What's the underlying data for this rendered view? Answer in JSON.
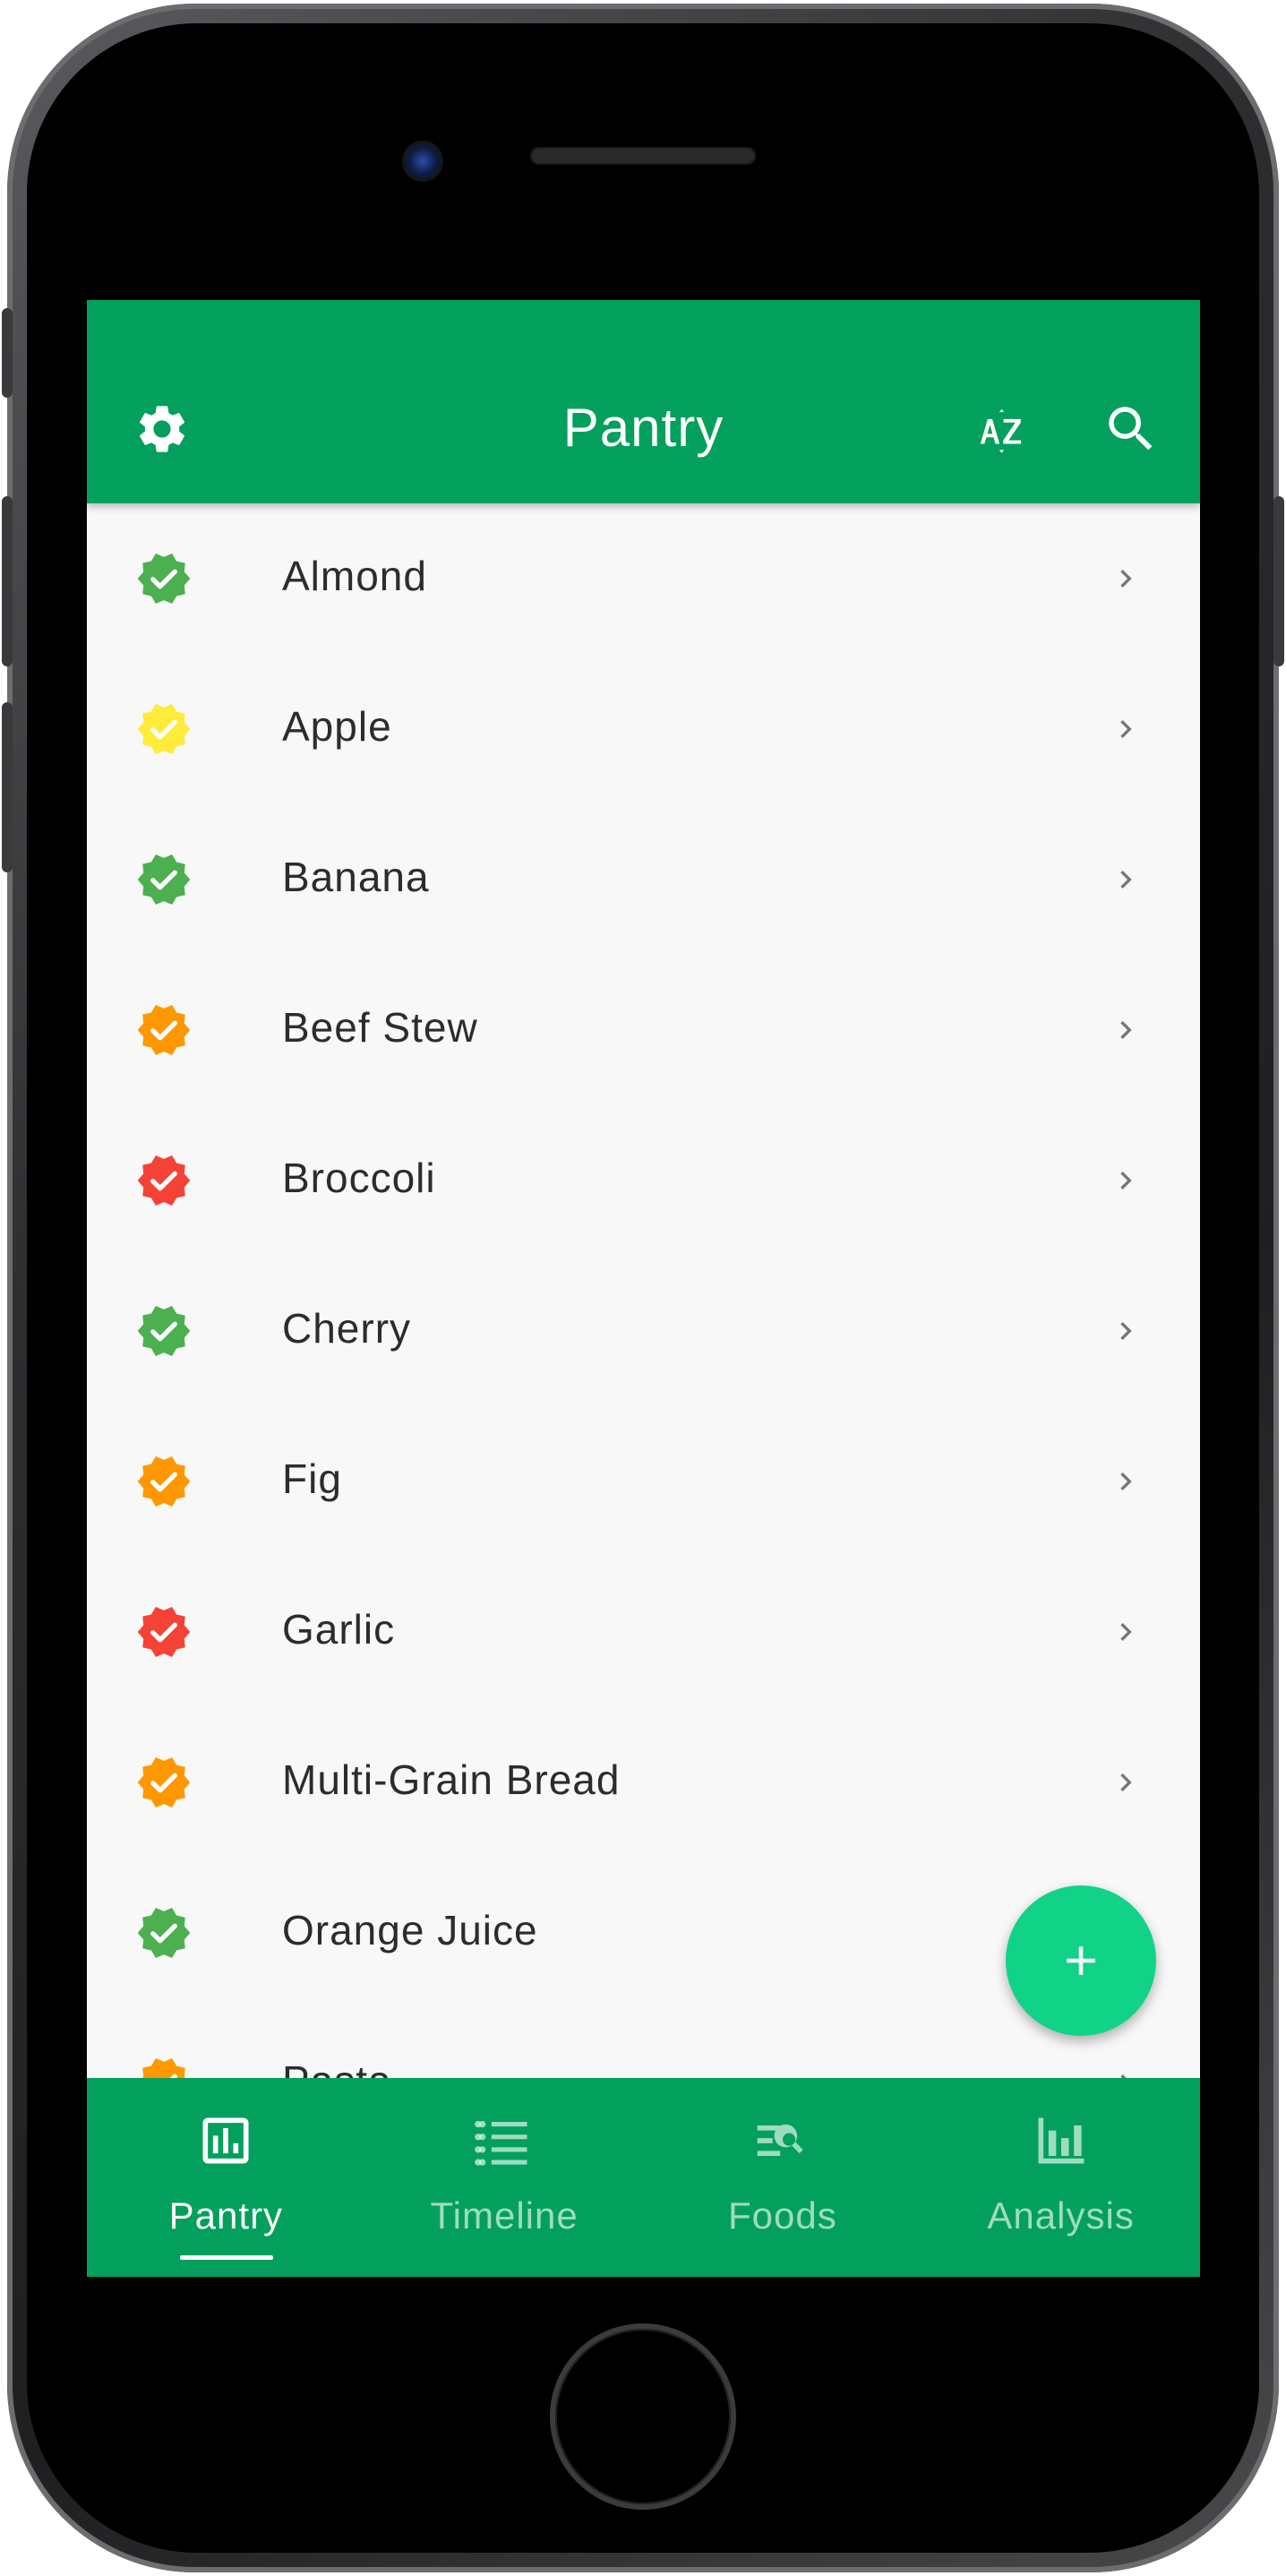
{
  "app_bar": {
    "title": "Pantry",
    "settings_icon": "gear-icon",
    "sort_icon": "sort-az-icon",
    "search_icon": "search-icon"
  },
  "pantry_items": [
    {
      "name": "Almond",
      "status_color": "#4caf50",
      "icon": "verified-badge-icon"
    },
    {
      "name": "Apple",
      "status_color": "#ffeb3b",
      "icon": "verified-badge-icon"
    },
    {
      "name": "Banana",
      "status_color": "#4caf50",
      "icon": "verified-badge-icon"
    },
    {
      "name": "Beef Stew",
      "status_color": "#ff9800",
      "icon": "verified-badge-icon"
    },
    {
      "name": "Broccoli",
      "status_color": "#f44336",
      "icon": "verified-badge-icon"
    },
    {
      "name": "Cherry",
      "status_color": "#4caf50",
      "icon": "verified-badge-icon"
    },
    {
      "name": "Fig",
      "status_color": "#ff9800",
      "icon": "verified-badge-icon"
    },
    {
      "name": "Garlic",
      "status_color": "#f44336",
      "icon": "verified-badge-icon"
    },
    {
      "name": "Multi-Grain Bread",
      "status_color": "#ff9800",
      "icon": "verified-badge-icon"
    },
    {
      "name": "Orange Juice",
      "status_color": "#4caf50",
      "icon": "verified-badge-icon"
    },
    {
      "name": "Pasta",
      "status_color": "#ff9800",
      "icon": "verified-badge-icon"
    }
  ],
  "fab": {
    "icon": "plus-icon"
  },
  "bottom_nav": {
    "items": [
      {
        "label": "Pantry",
        "icon": "pantry-icon",
        "active": true
      },
      {
        "label": "Timeline",
        "icon": "list-icon",
        "active": false
      },
      {
        "label": "Foods",
        "icon": "search-list-icon",
        "active": false
      },
      {
        "label": "Analysis",
        "icon": "bar-chart-icon",
        "active": false
      }
    ]
  },
  "colors": {
    "primary": "#02a05c",
    "fab": "#10d387",
    "background": "#f8f8f8"
  }
}
